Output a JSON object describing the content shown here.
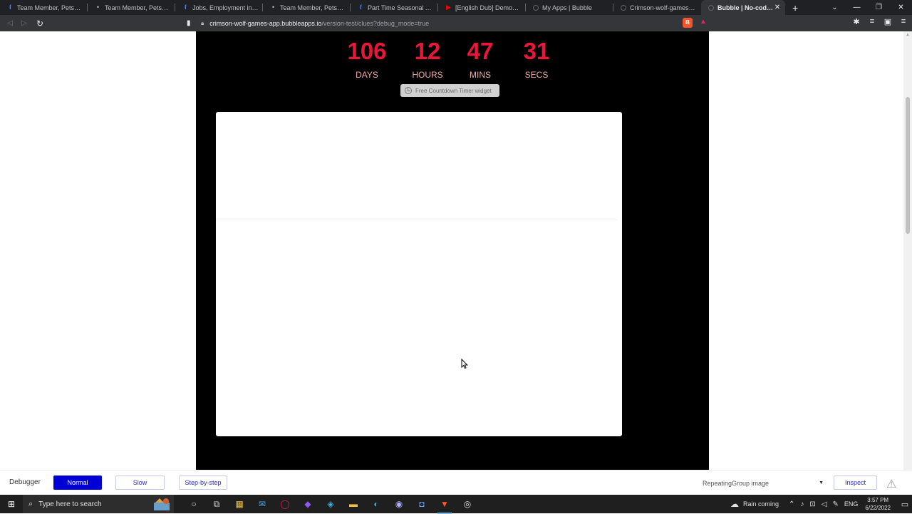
{
  "browser": {
    "tabs": [
      {
        "title": "Team Member, Petsense - L",
        "icon": "facebook-icon"
      },
      {
        "title": "Team Member, Petsense in",
        "icon": "dot-icon"
      },
      {
        "title": "Jobs, Employment in Los Lu",
        "icon": "facebook-icon"
      },
      {
        "title": "Team Member, Petsense in",
        "icon": "dot-icon"
      },
      {
        "title": "Part Time Seasonal Associ",
        "icon": "facebook-icon"
      },
      {
        "title": "[English Dub] Demon S",
        "icon": "youtube-icon"
      },
      {
        "title": "My Apps | Bubble",
        "icon": "bubble-icon"
      },
      {
        "title": "Crimson-wolf-games-app",
        "icon": "bubble-icon"
      }
    ],
    "active_tab": {
      "title": "Bubble | No-code apps",
      "close": "✕"
    },
    "new_tab": "+",
    "url": {
      "host": "crimson-wolf-games-app.bubbleapps.io",
      "path": "/version-test/clues?debug_mode=true"
    },
    "brave_badge": "B"
  },
  "countdown": {
    "days": {
      "value": "106",
      "label": "DAYS"
    },
    "hours": {
      "value": "12",
      "label": "HOURS"
    },
    "mins": {
      "value": "47",
      "label": "MINS"
    },
    "secs": {
      "value": "31",
      "label": "SECS"
    },
    "widget_link": "Free Countdown Timer widget"
  },
  "debugger": {
    "label": "Debugger",
    "modes": {
      "normal": "Normal",
      "slow": "Slow",
      "step": "Step-by-step"
    },
    "element_select": "RepeatingGroup image",
    "inspect": "Inspect"
  },
  "taskbar": {
    "search_placeholder": "Type here to search",
    "weather": "Rain coming",
    "language": "ENG",
    "time": "3:57 PM",
    "date": "6/22/2022"
  },
  "colors": {
    "countdown_number": "#e8173a",
    "countdown_label": "#f0a8a8",
    "debugger_active": "#0000d6"
  }
}
